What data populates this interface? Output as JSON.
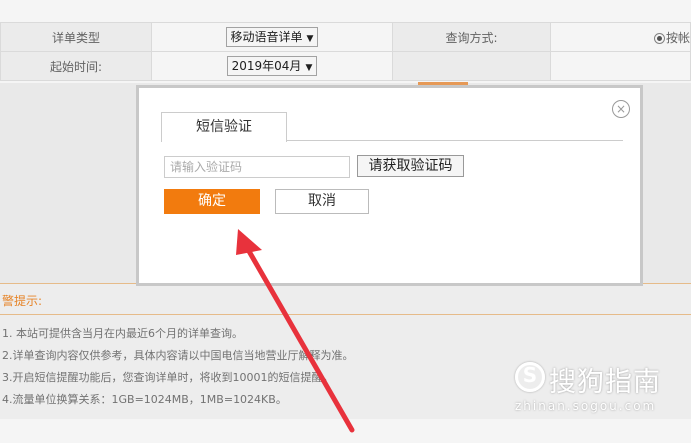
{
  "form": {
    "row1": {
      "label": "详单类型",
      "select": "移动语音详单",
      "query_label": "查询方式:",
      "query_value": "按帐"
    },
    "row2": {
      "label": "起始时间:",
      "select": "2019年04月"
    }
  },
  "tips": {
    "title": "警提示:",
    "items": [
      "1. 本站可提供含当月在内最近6个月的详单查询。",
      "2.详单查询内容仅供参考，具体内容请以中国电信当地营业厅解释为准。",
      "3.开启短信提醒功能后，您查询详单时，将收到10001的短信提醒。",
      "4.流量单位换算关系：1GB=1024MB，1MB=1024KB。"
    ]
  },
  "modal": {
    "tab": "短信验证",
    "code_placeholder": "请输入验证码",
    "get_code": "请获取验证码",
    "ok": "确定",
    "cancel": "取消",
    "close_symbol": "×"
  },
  "watermark": {
    "brand": "搜狗指南",
    "url": "zhinan.sogou.com"
  },
  "colors": {
    "accent": "#f27b0e",
    "arrow": "#e8323c"
  }
}
